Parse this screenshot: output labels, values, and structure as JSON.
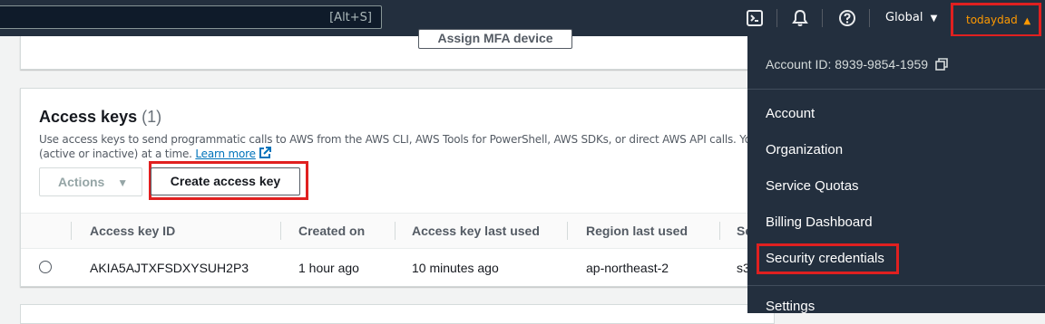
{
  "topbar": {
    "search_shortcut": "[Alt+S]",
    "region": "Global",
    "user": "todaydad",
    "icons": [
      "cloudshell-icon",
      "bell-icon",
      "help-icon"
    ]
  },
  "mfa_panel": {
    "assign_label": "Assign MFA device"
  },
  "access_keys": {
    "title": "Access keys",
    "count": "(1)",
    "desc_line1": "Use access keys to send programmatic calls to AWS from the AWS CLI, AWS Tools for PowerShell, AWS SDKs, or direct AWS API calls. You can",
    "desc_line2_prefix": "(active or inactive) at a time.",
    "learn_more": "Learn more",
    "actions_label": "Actions",
    "create_label": "Create access key",
    "columns": [
      "Access key ID",
      "Created on",
      "Access key last used",
      "Region last used",
      "Se"
    ],
    "rows": [
      {
        "id": "AKIA5AJTXFSDXYSUH2P3",
        "created": "1 hour ago",
        "last_used": "10 minutes ago",
        "region": "ap-northeast-2",
        "service": "s3"
      }
    ]
  },
  "account_menu": {
    "account_id": "Account ID: 8939-9854-1959",
    "items": [
      "Account",
      "Organization",
      "Service Quotas",
      "Billing Dashboard",
      "Security credentials",
      "Settings"
    ]
  },
  "colors": {
    "topbar": "#232f3e",
    "user_accent": "#ff9900",
    "highlight": "#e02020",
    "link": "#0073bb"
  }
}
